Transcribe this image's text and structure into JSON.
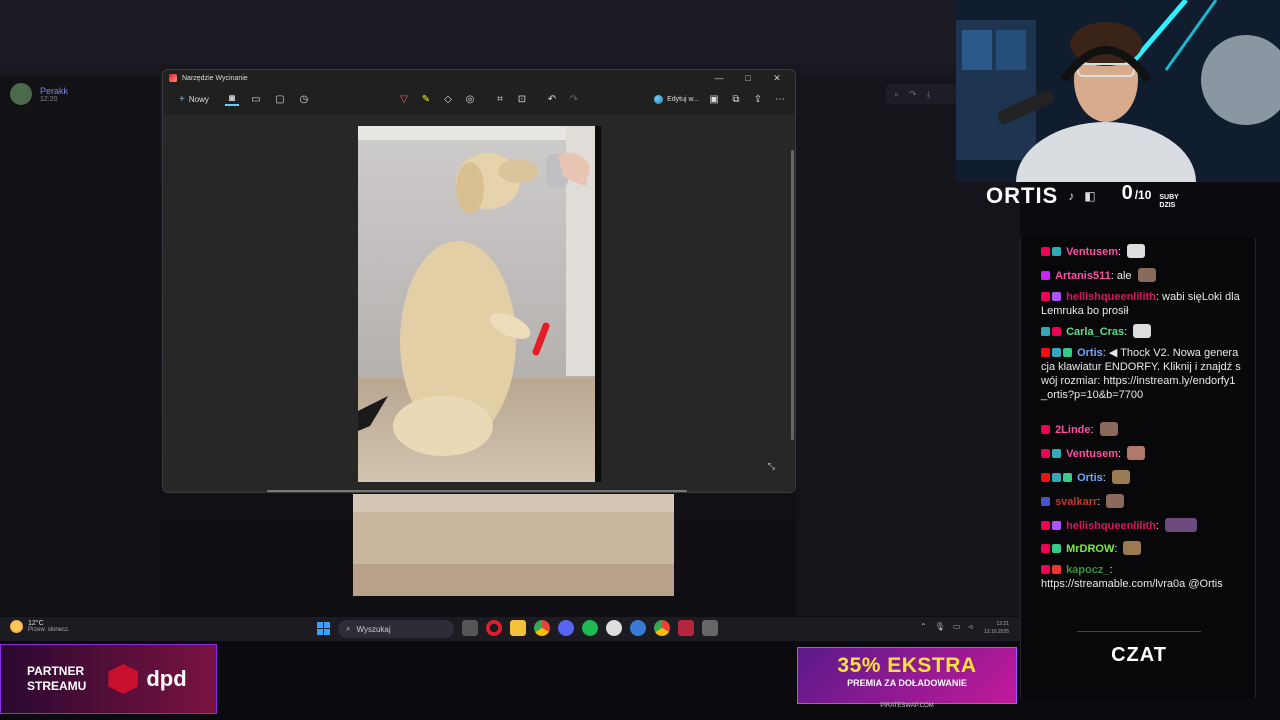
{
  "background": {
    "user_name": "Perakk",
    "user_time": "12:20"
  },
  "snip_window": {
    "title": "Narzędzie Wycinanie",
    "new_label": "Nowy",
    "edit_label": "Edytuj w...",
    "window_controls": [
      "minimize-icon",
      "maximize-icon",
      "close-icon"
    ],
    "toolbar_icons": [
      "screenshot-icon",
      "video-icon",
      "rect-mode-icon",
      "timer-icon"
    ],
    "center_icons": [
      "pen-icon",
      "highlighter-icon",
      "eraser-icon",
      "shapes-icon",
      "crop-icon",
      "text-actions-icon",
      "undo-icon",
      "redo-icon"
    ],
    "right_icons": [
      "save-icon",
      "copy-icon",
      "share-icon",
      "more-icon"
    ]
  },
  "taskbar": {
    "temperature": "12°C",
    "weather_desc": "Przew. słonecz.",
    "search_placeholder": "Wyszukaj",
    "clock_time": "12:21",
    "clock_date": "13.10.2025"
  },
  "partner": {
    "line1": "PARTNER",
    "line2": "STREAMU",
    "brand": "dpd"
  },
  "promo": {
    "headline": "35% EKSTRA",
    "subline": "PREMIA ZA DOŁADOWANIE",
    "url": "PIRATESWAP.COM"
  },
  "stream": {
    "name": "ORTIS",
    "subs_count": "0",
    "subs_goal": "/10",
    "subs_label_1": "SUBY",
    "subs_label_2": "DZIS"
  },
  "chat": {
    "label": "CZAT",
    "messages": [
      {
        "user": "Ventusem",
        "color": "#ff4fa0",
        "text": ""
      },
      {
        "user": "Artanis511",
        "color": "#ff4fa0",
        "text": "ale"
      },
      {
        "user": "hellishqueenlilith",
        "color": "#d9145f",
        "text": "wabi sięLoki dla Lemruka bo prosił"
      },
      {
        "user": "Carla_Cras",
        "color": "#5fdc8a",
        "text": ""
      },
      {
        "user": "Ortis",
        "color": "#6fa6ff",
        "text": "Thock V2. Nowa generacja klawiatur ENDORFY. Kliknij i znajdź swój rozmiar: https://instream.ly/endorfy1_ortis?p=10&b=7700"
      },
      {
        "user": "2Linde",
        "color": "#ff4fa0",
        "text": ""
      },
      {
        "user": "Ventusem",
        "color": "#ff4fa0",
        "text": ""
      },
      {
        "user": "Ortis",
        "color": "#6fa6ff",
        "text": ""
      },
      {
        "user": "svalkarr",
        "color": "#c0392b",
        "text": ""
      },
      {
        "user": "hellishqueenlilith",
        "color": "#d9145f",
        "text": ""
      },
      {
        "user": "MrDROW",
        "color": "#7bea4a",
        "text": ""
      },
      {
        "user": "kapocz_",
        "color": "#3a8f3a",
        "text": "https://streamable.com/lvra0a @Ortis"
      }
    ]
  }
}
